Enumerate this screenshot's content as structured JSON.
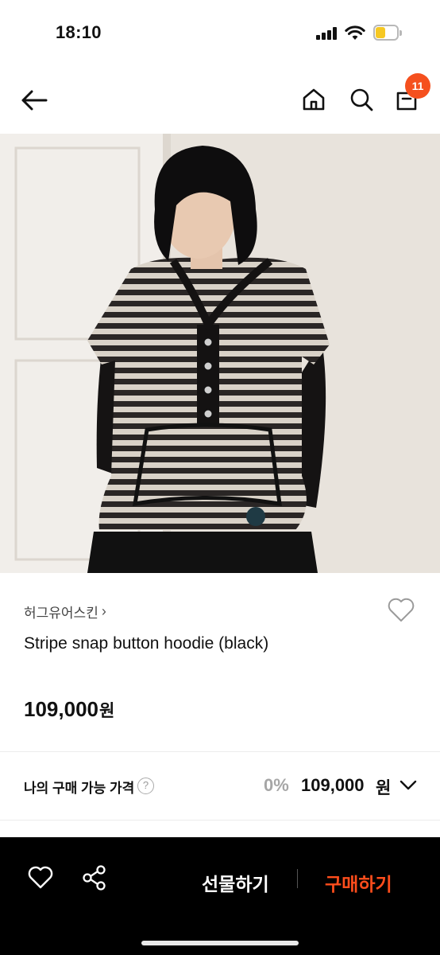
{
  "status_bar": {
    "time": "18:10"
  },
  "nav": {
    "cart_count": "11"
  },
  "product": {
    "brand": "허그유어스킨",
    "brand_chevron": "›",
    "title": "Stripe snap button hoodie (black)",
    "price": "109,000",
    "price_unit": "원"
  },
  "my_price": {
    "label": "나의 구매 가능 가격",
    "help": "?",
    "discount": "0%",
    "price": "109,000",
    "unit": "원"
  },
  "bottom_bar": {
    "gift_label": "선물하기",
    "buy_label": "구매하기"
  },
  "colors": {
    "accent": "#ff4d1c",
    "badge": "#f5501e",
    "bottom_bar_bg": "#000000"
  },
  "icons": [
    "back-arrow-icon",
    "home-icon",
    "search-icon",
    "cart-icon",
    "heart-icon",
    "share-icon",
    "chevron-down-icon",
    "question-icon"
  ]
}
